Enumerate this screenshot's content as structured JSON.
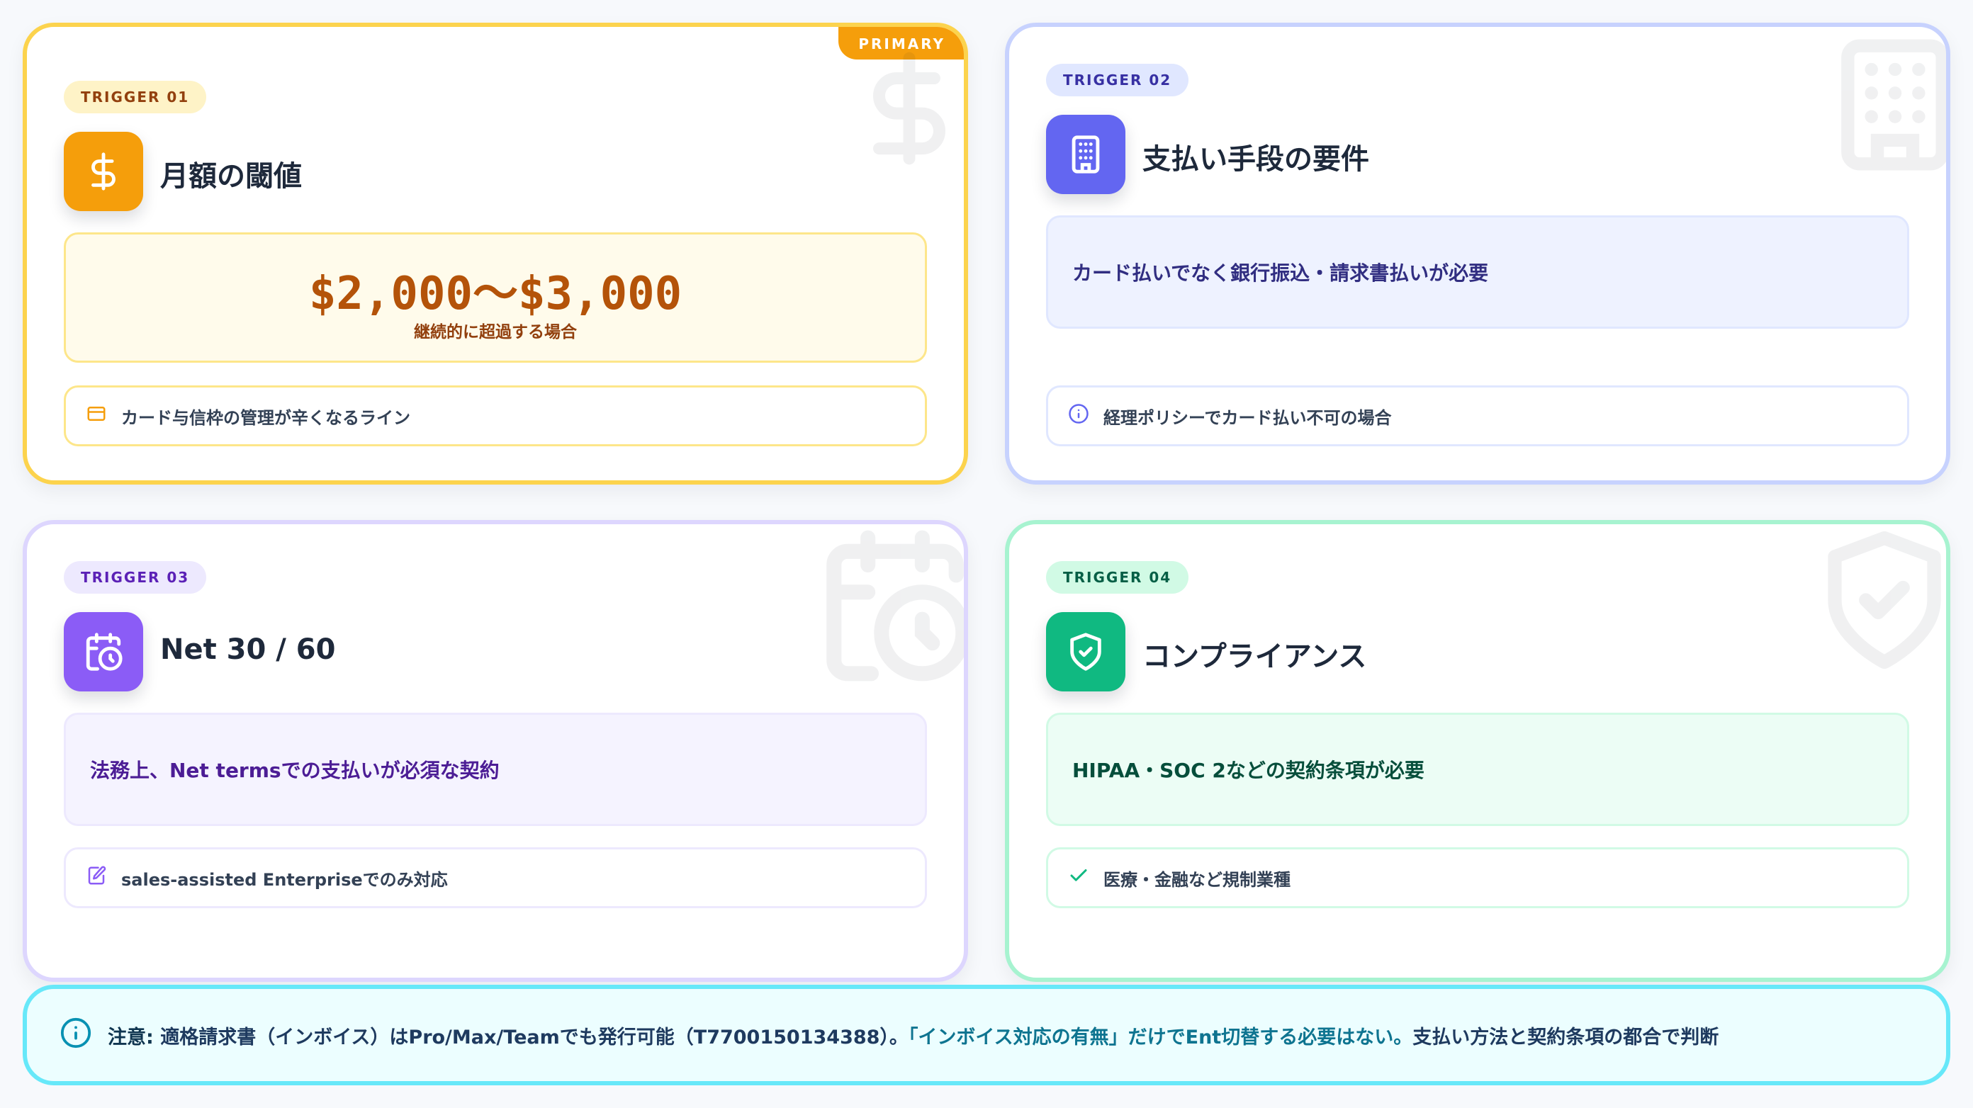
{
  "colors": {
    "card1_accent": "#f59e0b",
    "card2_accent": "#6366f1",
    "card3_accent": "#8b5cf6",
    "card4_accent": "#10b981",
    "notice_accent": "#0891b2"
  },
  "cards": [
    {
      "badge": "TRIGGER 01",
      "title": "月額の閾値",
      "icon": "dollar-icon",
      "primary_tag": "PRIMARY",
      "amount": "$2,000〜$3,000",
      "amount_sub": "継続的に超過する場合",
      "note": "カード与信枠の管理が辛くなるライン",
      "note_icon": "credit-card-icon"
    },
    {
      "badge": "TRIGGER 02",
      "title": "支払い手段の要件",
      "icon": "building-icon",
      "main_text": "カード払いでなく銀行振込・請求書払いが必要",
      "note": "経理ポリシーでカード払い不可の場合",
      "note_icon": "info-icon"
    },
    {
      "badge": "TRIGGER 03",
      "title": "Net 30 / 60",
      "icon": "calendar-clock-icon",
      "main_text": "法務上、Net termsでの支払いが必須な契約",
      "note": "sales-assisted Enterpriseでのみ対応",
      "note_icon": "edit-document-icon"
    },
    {
      "badge": "TRIGGER 04",
      "title": "コンプライアンス",
      "icon": "shield-check-icon",
      "main_text": "HIPAA・SOC 2などの契約条項が必要",
      "note": "医療・金融など規制業種",
      "note_icon": "check-icon"
    }
  ],
  "notice": {
    "icon": "info-icon",
    "label": "注意:",
    "text_before": "適格請求書（インボイス）はPro/Max/Teamでも発行可能（T7700150134388）。",
    "highlight": "「インボイス対応の有無」だけでEnt切替する必要はない。",
    "text_after": "支払い方法と契約条項の都合で判断"
  }
}
